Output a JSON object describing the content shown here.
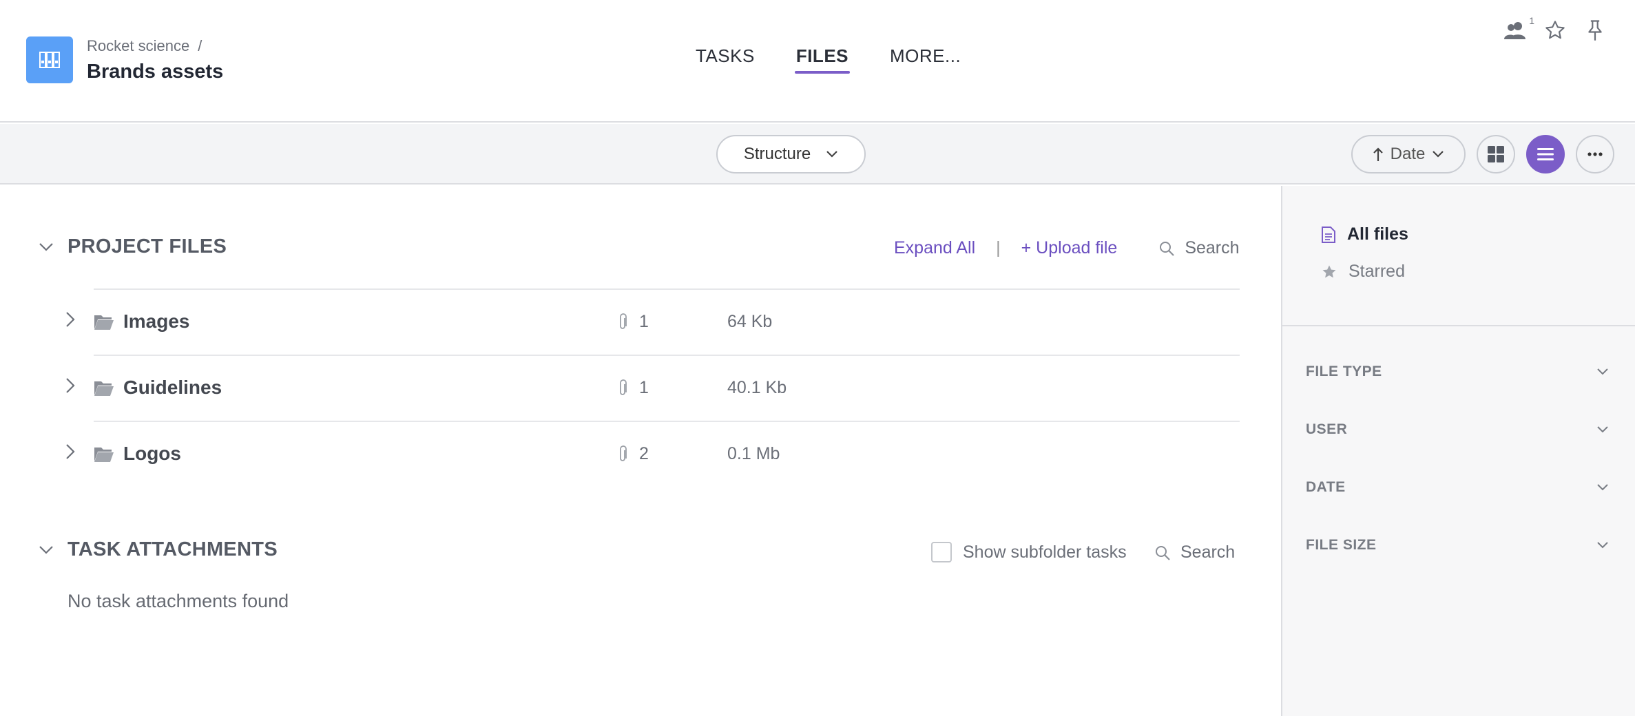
{
  "header": {
    "breadcrumb_parent": "Rocket science",
    "breadcrumb_sep": "/",
    "title": "Brands assets",
    "members_count": "1",
    "accent_color": "#7b5dc8",
    "project_icon_color": "#5aa0f7"
  },
  "tabs": [
    {
      "label": "TASKS",
      "active": false
    },
    {
      "label": "FILES",
      "active": true
    },
    {
      "label": "MORE...",
      "active": false
    }
  ],
  "toolbar": {
    "structure_label": "Structure",
    "sort_label": "Date",
    "sort_direction": "ascending",
    "view_mode": "list"
  },
  "project_files": {
    "title": "PROJECT FILES",
    "expand_all": "Expand All",
    "separator": "|",
    "upload": "+ Upload file",
    "search": "Search",
    "folders": [
      {
        "name": "Images",
        "count": "1",
        "size": "64 Kb"
      },
      {
        "name": "Guidelines",
        "count": "1",
        "size": "40.1 Kb"
      },
      {
        "name": "Logos",
        "count": "2",
        "size": "0.1 Mb"
      }
    ]
  },
  "task_attachments": {
    "title": "TASK ATTACHMENTS",
    "show_subfolder": "Show subfolder tasks",
    "search": "Search",
    "empty": "No task attachments found"
  },
  "sidebar": {
    "all_files": "All files",
    "starred": "Starred",
    "filters": [
      {
        "label": "FILE TYPE"
      },
      {
        "label": "USER"
      },
      {
        "label": "DATE"
      },
      {
        "label": "FILE SIZE"
      }
    ]
  }
}
